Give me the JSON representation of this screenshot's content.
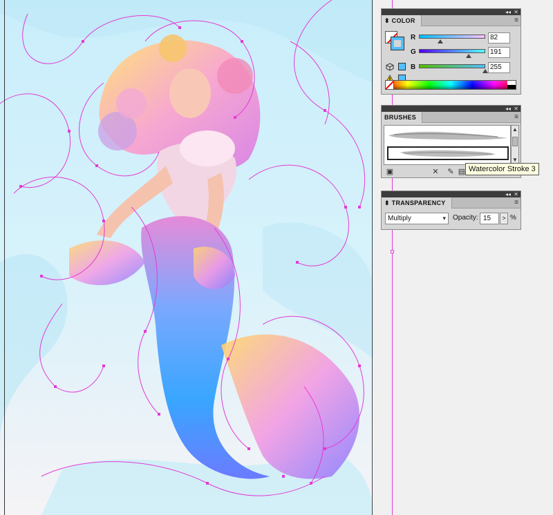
{
  "color_panel": {
    "title": "COLOR",
    "channels": [
      {
        "label": "R",
        "value": "82",
        "fraction": 0.32,
        "gradient": [
          "#00bfff",
          "#ffbfff"
        ]
      },
      {
        "label": "G",
        "value": "191",
        "fraction": 0.75,
        "gradient": [
          "#5200ff",
          "#52ffff"
        ]
      },
      {
        "label": "B",
        "value": "255",
        "fraction": 1.0,
        "gradient": [
          "#52bf00",
          "#52bfff"
        ]
      }
    ],
    "current_color": "#52bfff"
  },
  "brushes_panel": {
    "title": "BRUSHES",
    "tooltip": "Watercolor Stroke 3"
  },
  "transparency_panel": {
    "title": "TRANSPARENCY",
    "blend_mode": "Multiply",
    "opacity_label": "Opacity:",
    "opacity_value": "15",
    "opacity_unit": "%",
    "opacity_arrow": ">"
  },
  "icons": {
    "panel_collapse": "◂◂",
    "panel_close": "✕",
    "panel_menu": "≡",
    "dropdown": "▾"
  },
  "artwork": {
    "subject": "mermaid illustration with watercolor brush strokes",
    "accent_path_color": "#e33ad6"
  }
}
